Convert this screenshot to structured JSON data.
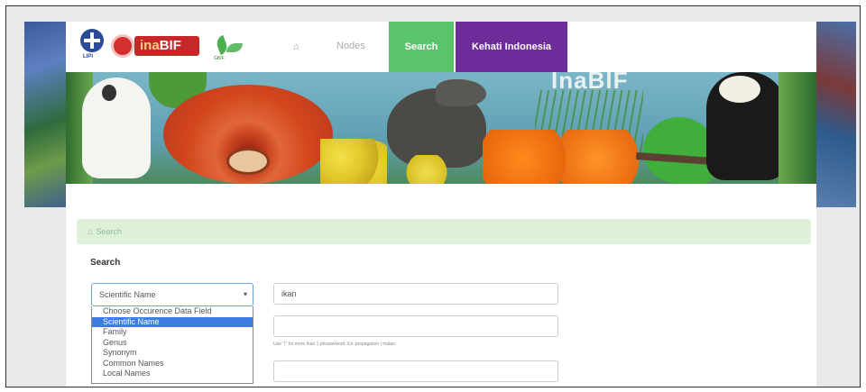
{
  "nav": {
    "lipi_label": "LIPI",
    "inabif_label_ina": "ina",
    "inabif_label_bif": "BIF",
    "gbif_label": "GBIF",
    "home_icon": "⌂",
    "nodes": "Nodes",
    "search": "Search",
    "kehati": "Kehati Indonesia",
    "search_bg": "#5cc36d",
    "kehati_bg": "#6d2c9a"
  },
  "banner": {
    "title": "InaBIF"
  },
  "breadcrumb": {
    "home_icon": "⌂",
    "label": "Search",
    "bg": "#dff0d8"
  },
  "form": {
    "heading": "Search",
    "field_select_value": "Scientific Name",
    "field_options": [
      "Choose Occurence Data Field",
      "Scientific Name",
      "Family",
      "Genus",
      "Synonym",
      "Common Names",
      "Local Names"
    ],
    "selected_option_index": 1,
    "keyword_value": "ikan",
    "hint": "Use \"|\" for more than 1 phrase/word. Ex: propagation | mutan"
  }
}
